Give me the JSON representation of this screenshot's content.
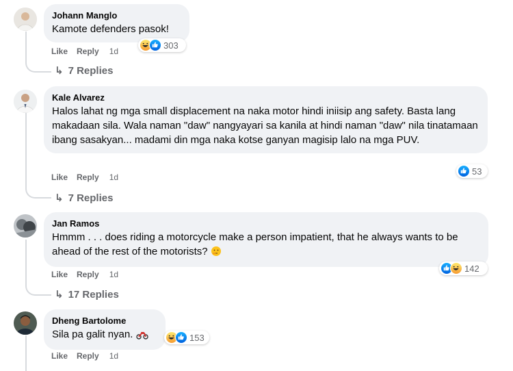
{
  "colors": {
    "bubble": "#f0f2f5",
    "meta": "#65676b",
    "like_blue": "#0866ff",
    "haha_yellow": "#f7b125"
  },
  "comments": [
    {
      "name": "Johann Manglo",
      "text": "Kamote defenders pasok!",
      "like": "Like",
      "reply": "Reply",
      "time": "1d",
      "reactions": [
        "haha",
        "like"
      ],
      "count": "303",
      "replies": "7 Replies"
    },
    {
      "name": "Kale Alvarez",
      "text": "Halos lahat ng mga small displacement na naka motor hindi iniisip ang safety. Basta lang makadaan sila. Wala naman \"daw\" nangyayari sa kanila at hindi naman \"daw\" nila tinatamaan ibang sasakyan... madami din mga naka kotse ganyan magisip lalo na mga PUV.",
      "like": "Like",
      "reply": "Reply",
      "time": "1d",
      "reactions": [
        "like"
      ],
      "count": "53",
      "replies": "7 Replies"
    },
    {
      "name": "Jan Ramos",
      "text": "Hmmm . . . does riding a motorcycle make a person impatient, that he always wants to be ahead of the rest of the motorists?",
      "trailing_emoji": "thinking-face",
      "like": "Like",
      "reply": "Reply",
      "time": "1d",
      "reactions": [
        "like",
        "haha"
      ],
      "count": "142",
      "replies": "17 Replies"
    },
    {
      "name": "Dheng Bartolome",
      "text": "Sila pa galit nyan.",
      "trailing_emoji": "motorcycle",
      "like": "Like",
      "reply": "Reply",
      "time": "1d",
      "reactions": [
        "haha",
        "like"
      ],
      "count": "153"
    }
  ]
}
